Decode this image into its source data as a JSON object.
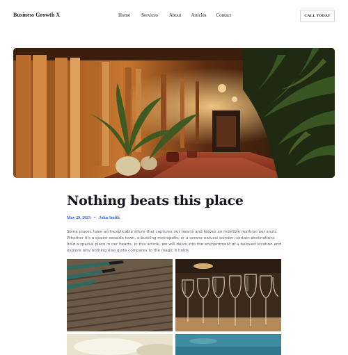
{
  "header": {
    "brand": "Business Growth X",
    "nav": [
      {
        "label": "Home"
      },
      {
        "label": "Services"
      },
      {
        "label": "About"
      },
      {
        "label": "Articles"
      },
      {
        "label": "Contact"
      }
    ],
    "cta_label": "CALL TODAY"
  },
  "article": {
    "title": "Nothing beats this place",
    "date": "May 29, 2023",
    "separator": "•",
    "author": "John Smith",
    "excerpt": "Some places have an inexplicable allure that captures our hearts and leaves an indelible mark on our souls. Whether it's a quaint seaside town, a bustling metropolis, or a serene natural wonder, certain destinations hold a special place in our hearts. In this article, we will delve into the enchantment of a beloved location and explore why nothing else quite compares to the magic it holds."
  },
  "colors": {
    "accent": "#2d5bd4",
    "heading": "#141421",
    "body_text": "#5a5e70"
  }
}
